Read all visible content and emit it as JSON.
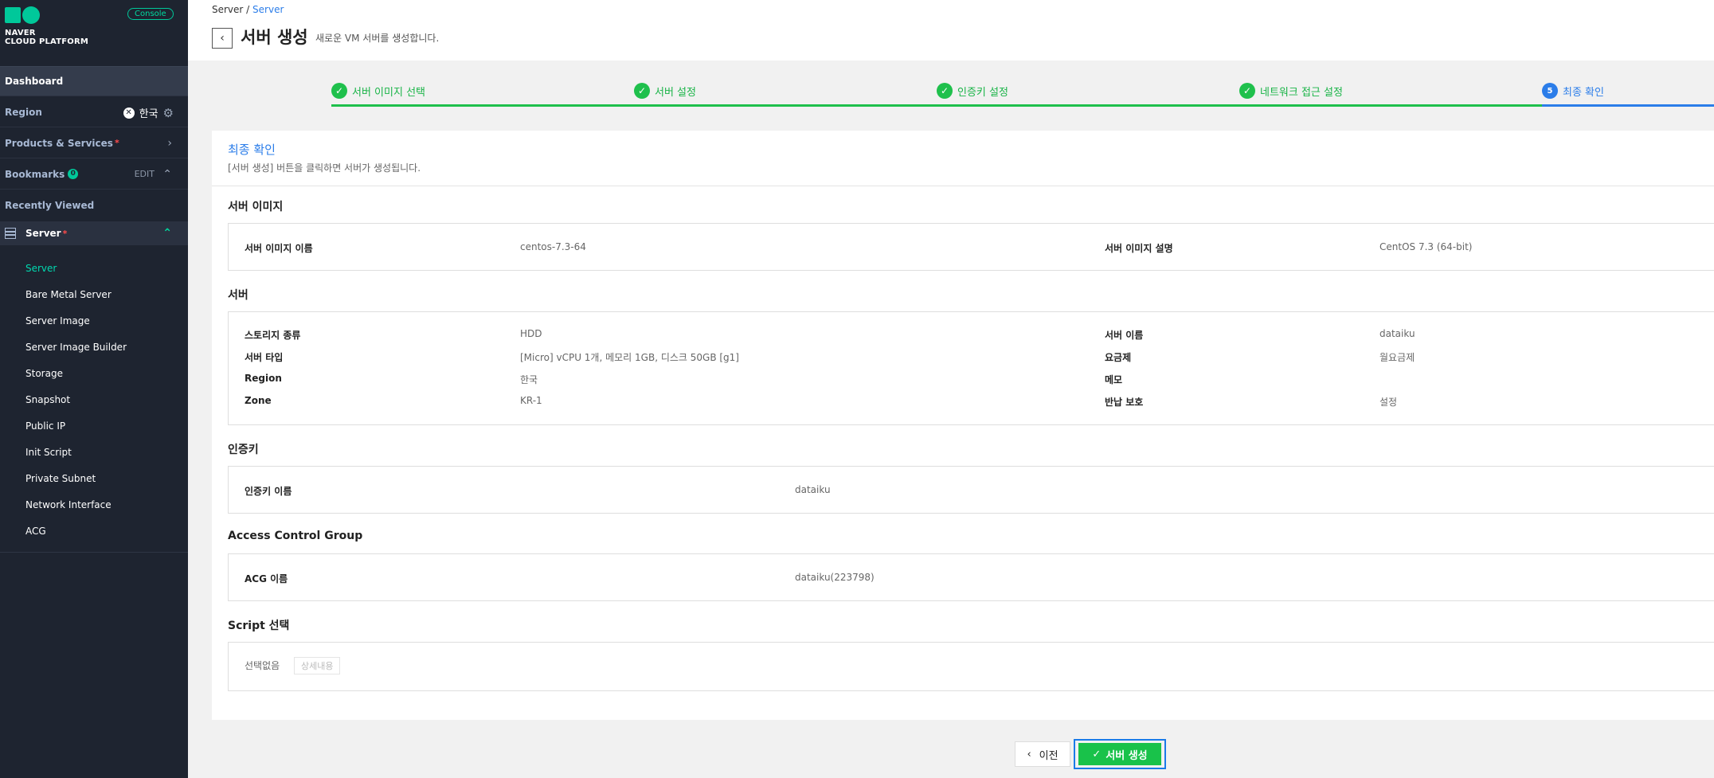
{
  "brand": {
    "logo_line1": "NAVER",
    "logo_line2": "CLOUD PLATFORM",
    "console_badge": "Console"
  },
  "sidebar": {
    "dashboard": "Dashboard",
    "region_label": "Region",
    "region_value": "한국",
    "products": "Products & Services",
    "bookmarks": "Bookmarks",
    "bookmarks_count": "0",
    "bookmarks_edit": "EDIT",
    "recently_viewed": "Recently Viewed",
    "server_group": "Server",
    "items": [
      {
        "label": "Server",
        "active": true
      },
      {
        "label": "Bare Metal Server"
      },
      {
        "label": "Server Image"
      },
      {
        "label": "Server Image Builder"
      },
      {
        "label": "Storage"
      },
      {
        "label": "Snapshot"
      },
      {
        "label": "Public IP"
      },
      {
        "label": "Init Script"
      },
      {
        "label": "Private Subnet"
      },
      {
        "label": "Network Interface"
      },
      {
        "label": "ACG"
      }
    ]
  },
  "header": {
    "breadcrumb_root": "Server /",
    "breadcrumb_current": "Server",
    "title": "서버 생성",
    "subtitle": "새로운 VM 서버를 생성합니다."
  },
  "stepper": {
    "steps": [
      {
        "label": "서버 이미지 선택",
        "status": "done"
      },
      {
        "label": "서버 설정",
        "status": "done"
      },
      {
        "label": "인증키 설정",
        "status": "done"
      },
      {
        "label": "네트워크 접근 설정",
        "status": "done"
      },
      {
        "label": "최종 확인",
        "status": "current",
        "number": "5"
      }
    ]
  },
  "panel": {
    "title": "최종 확인",
    "subtitle": "[서버 생성] 버튼을 클릭하면 서버가 생성됩니다.",
    "sections": {
      "image": {
        "title": "서버 이미지",
        "name_label": "서버 이미지 이름",
        "name_value": "centos-7.3-64",
        "desc_label": "서버 이미지 설명",
        "desc_value": "CentOS 7.3 (64-bit)"
      },
      "server": {
        "title": "서버",
        "storage_label": "스토리지 종류",
        "storage_value": "HDD",
        "type_label": "서버 타입",
        "type_value": "[Micro] vCPU 1개, 메모리 1GB, 디스크 50GB [g1]",
        "region_label": "Region",
        "region_value": "한국",
        "zone_label": "Zone",
        "zone_value": "KR-1",
        "name_label": "서버 이름",
        "name_value": "dataiku",
        "plan_label": "요금제",
        "plan_value": "월요금제",
        "memo_label": "메모",
        "memo_value": "",
        "protect_label": "반납 보호",
        "protect_value": "설정"
      },
      "auth": {
        "title": "인증키",
        "name_label": "인증키 이름",
        "name_value": "dataiku"
      },
      "acg": {
        "title": "Access Control Group",
        "name_label": "ACG 이름",
        "name_value": "dataiku(223798)"
      },
      "script": {
        "title": "Script 선택",
        "none_label": "선택없음",
        "detail_button": "상세내용"
      }
    }
  },
  "footer": {
    "prev_button": "이전",
    "create_button": "서버 생성"
  },
  "colors": {
    "accent_green": "#1fc04c",
    "accent_blue": "#2b7de9",
    "sidebar_bg": "#1e2430",
    "brand_teal": "#00c89a"
  }
}
